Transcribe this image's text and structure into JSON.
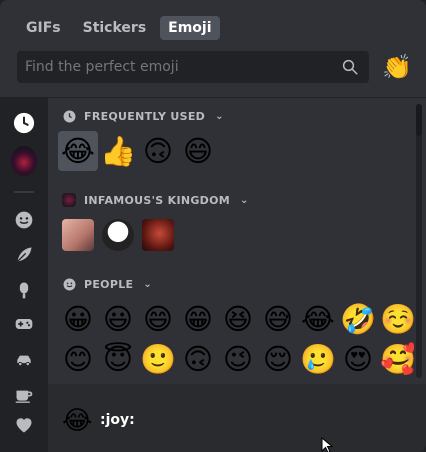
{
  "tabs": [
    {
      "label": "GIFs"
    },
    {
      "label": "Stickers"
    },
    {
      "label": "Emoji",
      "active": true
    }
  ],
  "search": {
    "placeholder": "Find the perfect emoji",
    "icon": "search-icon"
  },
  "random_emoji_button": {
    "emoji": "👏"
  },
  "sidebar": {
    "items": [
      {
        "name": "recent-icon",
        "glyph": "🕒",
        "active": true
      },
      {
        "name": "guild-icon",
        "glyph": ""
      },
      {
        "name": "people-icon",
        "glyph": "☺"
      },
      {
        "name": "nature-icon",
        "glyph": "🍃"
      },
      {
        "name": "food-icon",
        "glyph": "🍦"
      },
      {
        "name": "activities-icon",
        "glyph": "🎮"
      },
      {
        "name": "travel-icon",
        "glyph": "🚗"
      },
      {
        "name": "objects-icon",
        "glyph": "☕"
      },
      {
        "name": "symbols-icon",
        "glyph": "♥"
      }
    ]
  },
  "categories": {
    "frequent": {
      "label": "FREQUENTLY USED",
      "emojis": [
        "😂",
        "👍",
        "🙃",
        "😄"
      ]
    },
    "guild": {
      "label": "INFAMOUS'S KINGDOM",
      "emoji_count": 3
    },
    "people": {
      "label": "PEOPLE",
      "rows": [
        [
          "😀",
          "😃",
          "😄",
          "😁",
          "😆",
          "😅",
          "😂",
          "🤣",
          "☺️"
        ],
        [
          "😊",
          "😇",
          "🙂",
          "🙃",
          "😉",
          "😌",
          "🥲",
          "😍",
          "🥰"
        ],
        [
          "😘",
          "😗",
          "😙",
          "😚",
          "😋",
          "😛",
          "😝",
          "😜",
          "🤪"
        ]
      ]
    }
  },
  "footer": {
    "emoji": "😂",
    "name": ":joy:"
  },
  "colors": {
    "bg": "#2f3136",
    "sidebar": "#202225",
    "active_tab": "#4f545c",
    "footer": "#292b2f"
  }
}
